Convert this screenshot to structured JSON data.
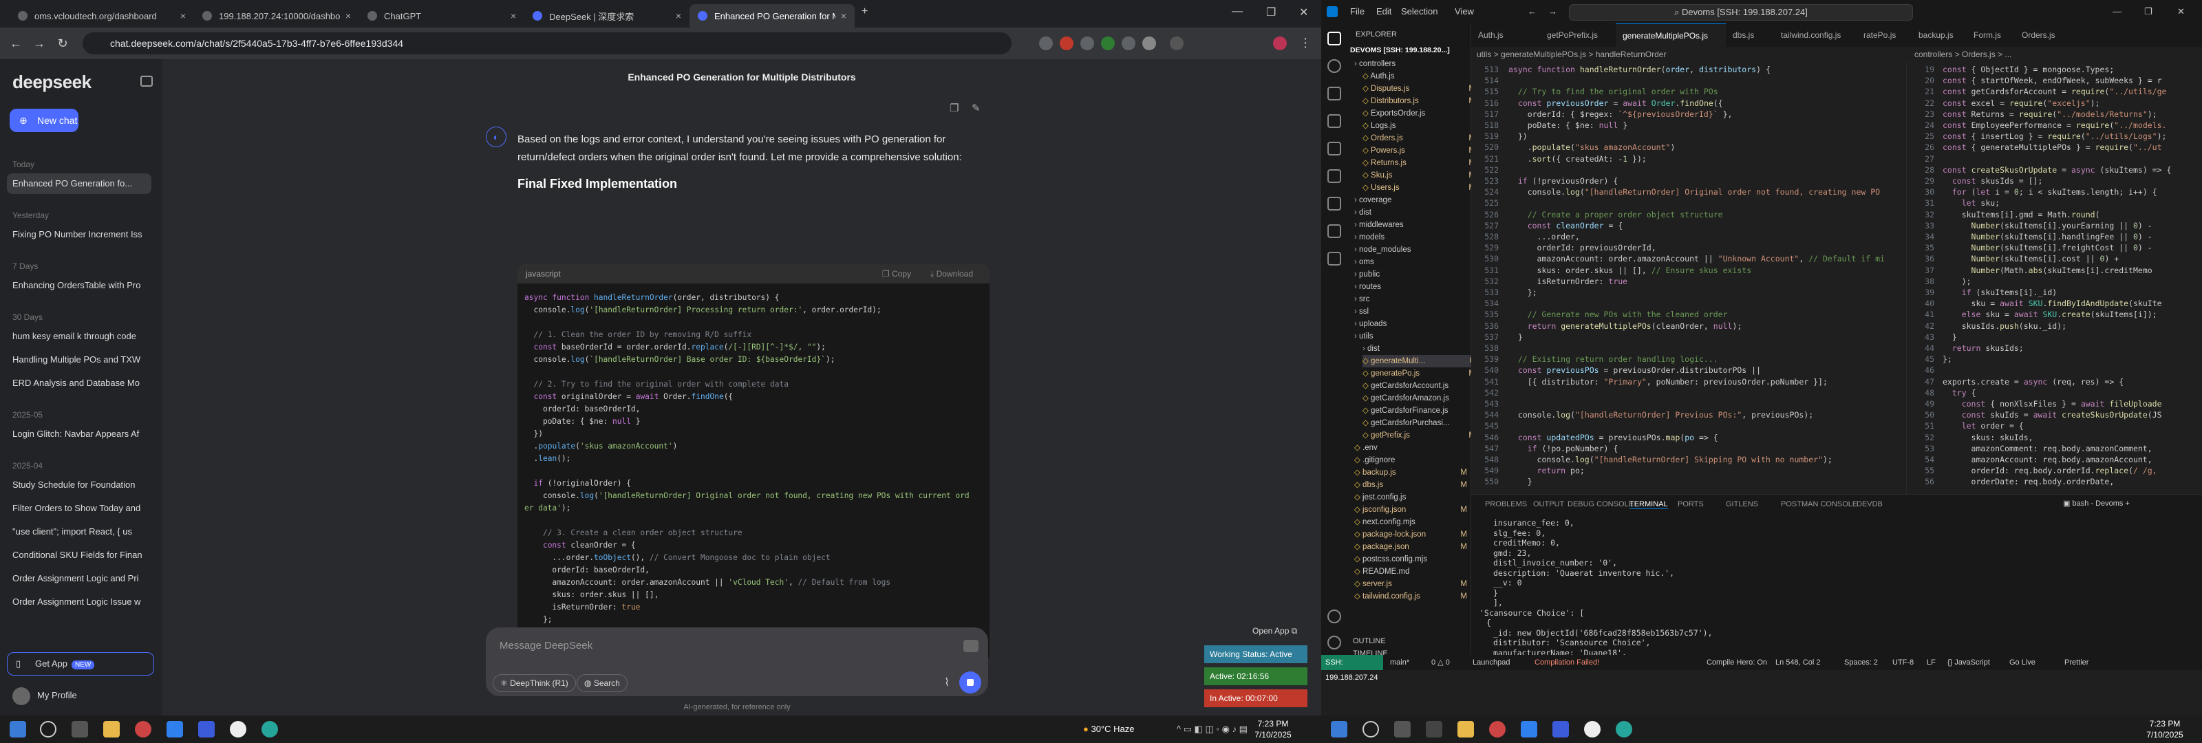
{
  "browser": {
    "tabs": [
      {
        "title": "oms.vcloudtech.org/dashboard"
      },
      {
        "title": "199.188.207.24:10000/dashboard"
      },
      {
        "title": "ChatGPT"
      },
      {
        "title": "DeepSeek | 深度求索"
      },
      {
        "title": "Enhanced PO Generation for M..."
      }
    ],
    "url": "chat.deepseek.com/a/chat/s/2f5440a5-17b3-4ff7-b7e6-6ffee193d344"
  },
  "deepseek": {
    "logo": "deepseek",
    "new_chat": "New chat",
    "chat_title": "Enhanced PO Generation for Multiple Distributors",
    "groups": [
      {
        "label": "Today",
        "items": [
          "Enhanced PO Generation fo..."
        ]
      },
      {
        "label": "Yesterday",
        "items": [
          "Fixing PO Number Increment Iss"
        ]
      },
      {
        "label": "7 Days",
        "items": [
          "Enhancing OrdersTable with Pro"
        ]
      },
      {
        "label": "30 Days",
        "items": [
          "hum kesy email k through code",
          "Handling Multiple POs and TXW",
          "ERD Analysis and Database Mo"
        ]
      },
      {
        "label": "2025-05",
        "items": [
          "Login Glitch: Navbar Appears Af"
        ]
      },
      {
        "label": "2025-04",
        "items": [
          "Study Schedule for Foundation",
          "Filter Orders to Show Today and",
          "\"use client\"; import React, { us",
          "Conditional SKU Fields for Finan",
          "Order Assignment Logic and Pri",
          "Order Assignment Logic Issue w"
        ]
      }
    ],
    "get_app": "Get App",
    "new_badge": "NEW",
    "profile": "My Profile",
    "answer_intro": "Based on the logs and error context, I understand you're seeing issues with PO generation for return/defect orders when the original order isn't found. Let me provide a comprehensive solution:",
    "answer_heading": "Final Fixed Implementation",
    "code_lang": "javascript",
    "copy": "Copy",
    "download": "Download",
    "input_placeholder": "Message DeepSeek",
    "deepthink": "DeepThink (R1)",
    "search": "Search",
    "disclaimer": "AI-generated, for reference only"
  },
  "widget": {
    "open_app": "Open App",
    "working": "Working Status: Active",
    "active": "Active: 02:16:56",
    "inactive": "In Active: 00:07:00"
  },
  "vscode": {
    "menus": [
      "File",
      "Edit",
      "Selection",
      "View"
    ],
    "search": "Devoms [SSH: 199.188.207.24]",
    "explorer_title": "EXPLORER",
    "root": "DEVOMS [SSH: 199.188.20...]",
    "files": [
      "controllers",
      "Auth.js",
      "Disputes.js",
      "Distributors.js",
      "ExportsOrder.js",
      "Logs.js",
      "Orders.js",
      "Powers.js",
      "Returns.js",
      "Sku.js",
      "Users.js",
      "coverage",
      "dist",
      "middlewares",
      "models",
      "node_modules",
      "oms",
      "public",
      "routes",
      "src",
      "ssl",
      "uploads",
      "utils",
      "dist",
      "generateMulti...",
      "generatePo.js",
      "getCardsforAccount.js",
      "getCardsforAmazon.js",
      "getCardsforFinance.js",
      "getCardsforPurchasi...",
      "getPrefix.js",
      ".env",
      ".gitignore",
      "backup.js",
      "dbs.js",
      "jest.config.js",
      "jsconfig.json",
      "next.config.mjs",
      "package-lock.json",
      "package.json",
      "postcss.config.mjs",
      "README.md",
      "server.js",
      "tailwind.config.js"
    ],
    "tabs": [
      "Auth.js",
      "getPoPrefix.js",
      "generateMultiplePOs.js",
      "dbs.js",
      "tailwind.config.js",
      "ratePo.js",
      "backup.js",
      "Form.js",
      "Orders.js"
    ],
    "breadcrumb_left": "utils > generateMultiplePOs.js > handleReturnOrder",
    "breadcrumb_right": "controllers > Orders.js > ...",
    "panel_tabs": [
      "PROBLEMS",
      "OUTPUT",
      "DEBUG CONSOLE",
      "TERMINAL",
      "PORTS",
      "GITLENS",
      "POSTMAN CONSOLE",
      "DEVDB"
    ],
    "terminal_label": "bash - Devoms",
    "terminal_lines": [
      "insurance_fee: 0,",
      "slg_fee: 0,",
      "creditMemo: 0,",
      "gmd: 23,",
      "distl_invoice_number: '0',",
      "description: 'Quaerat inventore hic.',",
      "__v: 0",
      "}",
      "],",
      "'Scansource Choice': [",
      "{",
      "_id: new ObjectId('686fcad28f858eb1563b7c57'),",
      "distributor: 'Scansource Choice',",
      "manufacturerName: 'Duane18',"
    ],
    "outline": "OUTLINE",
    "timeline": "TIMELINE",
    "status": [
      "SSH: 199.188.207.24",
      "main*",
      "0 △ 0",
      "Launchpad",
      "Compilation Failed!",
      "Compile Hero: On",
      "Ln 548, Col 2",
      "Spaces: 2",
      "UTF-8",
      "LF",
      "{} JavaScript",
      "Go Live",
      "Prettier"
    ]
  },
  "taskbar": {
    "weather": "30°C  Haze",
    "time": "7:23 PM",
    "date": "7/10/2025"
  }
}
